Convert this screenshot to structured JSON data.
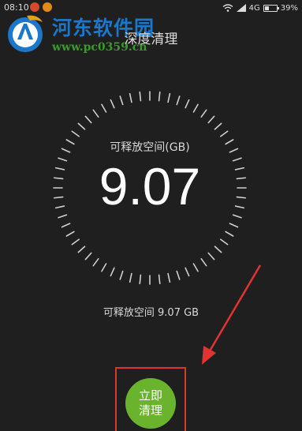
{
  "status_bar": {
    "time": "08:10",
    "network": "4G",
    "battery_percent": "39%",
    "battery_level": 0.39
  },
  "watermark": {
    "title": "河东软件园",
    "url": "www.pc0359.cn"
  },
  "header": {
    "title": "深度清理"
  },
  "gauge": {
    "label": "可释放空间(GB)",
    "value": "9.07"
  },
  "summary": {
    "text": "可释放空间 9.07 GB"
  },
  "action": {
    "line1": "立即",
    "line2": "清理"
  },
  "colors": {
    "background": "#1f1f1f",
    "button": "#69b32d",
    "annotation": "#e23232",
    "watermark_blue": "#1a77c9",
    "watermark_green": "#3a9a2c"
  }
}
